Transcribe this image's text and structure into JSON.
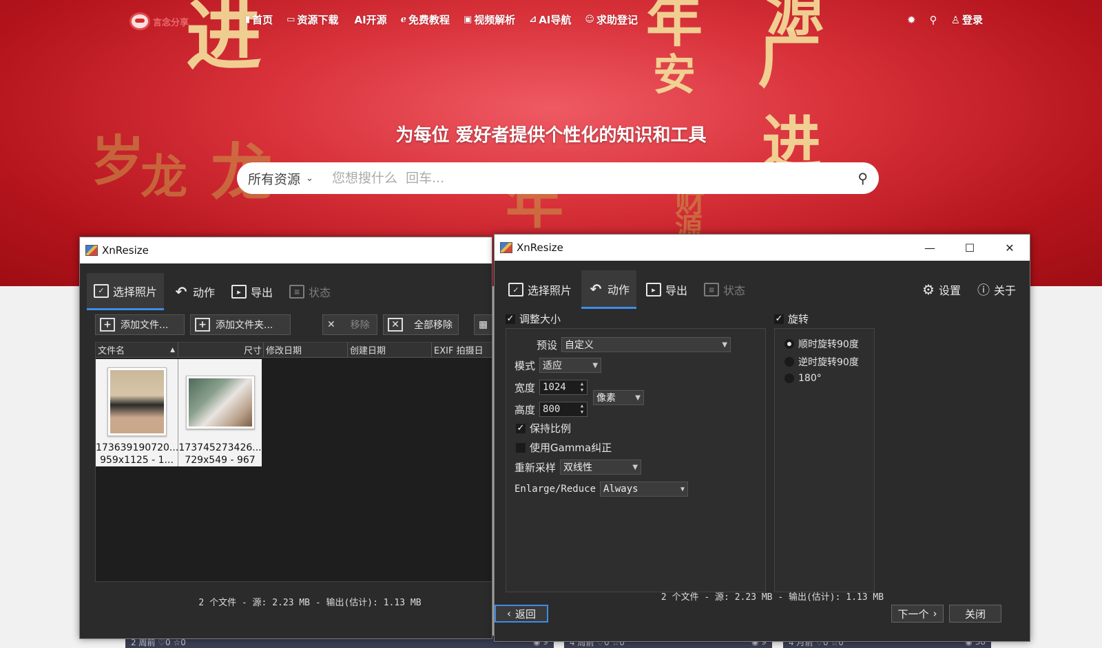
{
  "site": {
    "logo_text": "言念分享",
    "nav": [
      {
        "label": "首页",
        "icon": "home-icon"
      },
      {
        "label": "资源下载",
        "icon": "laptop-icon"
      },
      {
        "label": "AI开源",
        "icon": "ai-icon"
      },
      {
        "label": "免费教程",
        "icon": "ie-icon"
      },
      {
        "label": "视频解析",
        "icon": "video-icon"
      },
      {
        "label": "AI导航",
        "icon": "nav-icon"
      },
      {
        "label": "求助登记",
        "icon": "smile-icon"
      }
    ],
    "login_label": "登录",
    "hero_title": "为每位 爱好者提供个性化的知识和工具",
    "search_scope": "所有资源",
    "search_placeholder": "您想搜什么  回车...",
    "decorations": [
      "进",
      "年",
      "安",
      "源",
      "广",
      "进",
      "岁",
      "龙",
      "龙",
      "年",
      "财",
      "源"
    ],
    "cards": [
      {
        "meta": "2 周前  ♡0  ☆0",
        "views": "9"
      },
      {
        "meta": "4 周前  ♡0  ☆0",
        "views": "9"
      },
      {
        "meta": "4 月前  ♡0  ☆0",
        "views": "38"
      }
    ]
  },
  "left_window": {
    "title": "XnResize",
    "tabs": [
      "选择照片",
      "动作",
      "导出",
      "状态"
    ],
    "buttons": {
      "add_files": "添加文件...",
      "add_folder": "添加文件夹...",
      "remove": "移除",
      "remove_all": "全部移除"
    },
    "columns": [
      "文件名",
      "尺寸",
      "修改日期",
      "创建日期",
      "EXIF 拍摄日"
    ],
    "files": [
      {
        "name": "173639190720...",
        "info": "959x1125 - 1..."
      },
      {
        "name": "173745273426...",
        "info": "729x549 - 967"
      }
    ],
    "status": "2 个文件 - 源: 2.23 MB - 输出(估计): 1.13 MB"
  },
  "right_window": {
    "title": "XnResize",
    "tabs": [
      "选择照片",
      "动作",
      "导出",
      "状态"
    ],
    "settings_label": "设置",
    "about_label": "关于",
    "resize": {
      "label": "调整大小",
      "preset_label": "预设",
      "preset_value": "自定义",
      "mode_label": "模式",
      "mode_value": "适应",
      "width_label": "宽度",
      "width_value": "1024",
      "height_label": "高度",
      "height_value": "800",
      "unit_value": "像素",
      "keep_ratio": "保持比例",
      "gamma": "使用Gamma纠正",
      "resample_label": "重新采样",
      "resample_value": "双线性",
      "enlarge_label": "Enlarge/Reduce",
      "enlarge_value": "Always"
    },
    "rotate": {
      "label": "旋转",
      "options": [
        "顺时旋转90度",
        "逆时旋转90度",
        "180°"
      ]
    },
    "status": "2 个文件 - 源: 2.23 MB - 输出(估计): 1.13 MB",
    "back_label": "返回",
    "next_label": "下一个",
    "close_label": "关闭"
  }
}
